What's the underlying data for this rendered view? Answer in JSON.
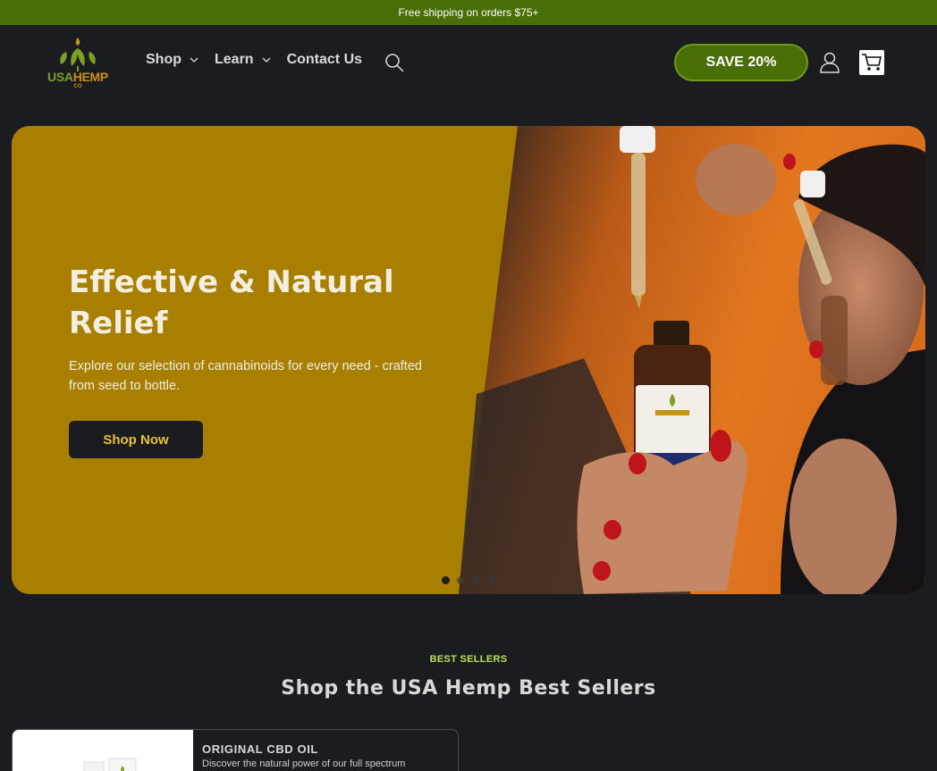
{
  "announcement": {
    "text": "Free shipping on orders $75+"
  },
  "logo": {
    "word_a": "USA",
    "word_b": "HEMP",
    "co": "CO"
  },
  "nav": {
    "items": [
      {
        "label": "Shop",
        "has_dropdown": true
      },
      {
        "label": "Learn",
        "has_dropdown": true
      },
      {
        "label": "Contact Us",
        "has_dropdown": false
      }
    ],
    "search_icon": "search-icon"
  },
  "header_actions": {
    "save_label": "SAVE 20%",
    "account_icon": "account-icon",
    "cart_icon": "cart-icon"
  },
  "hero": {
    "title": "Effective & Natural Relief",
    "subtitle": "Explore our selection of cannabinoids for every need - crafted from seed to bottle.",
    "cta_label": "Shop Now",
    "slide_count": 4,
    "active_slide": 1
  },
  "best_sellers": {
    "eyebrow": "BEST SELLERS",
    "title": "Shop the USA Hemp Best Sellers",
    "products": [
      {
        "name": "ORIGINAL CBD OIL",
        "description": "Discover the natural power of our full spectrum"
      }
    ]
  },
  "colors": {
    "background": "#1b1c20",
    "announcement_bar": "#4a6e06",
    "hero_panel": "#a97f00",
    "eyebrow_accent": "#b9e35a",
    "cta_text": "#e8c233"
  }
}
